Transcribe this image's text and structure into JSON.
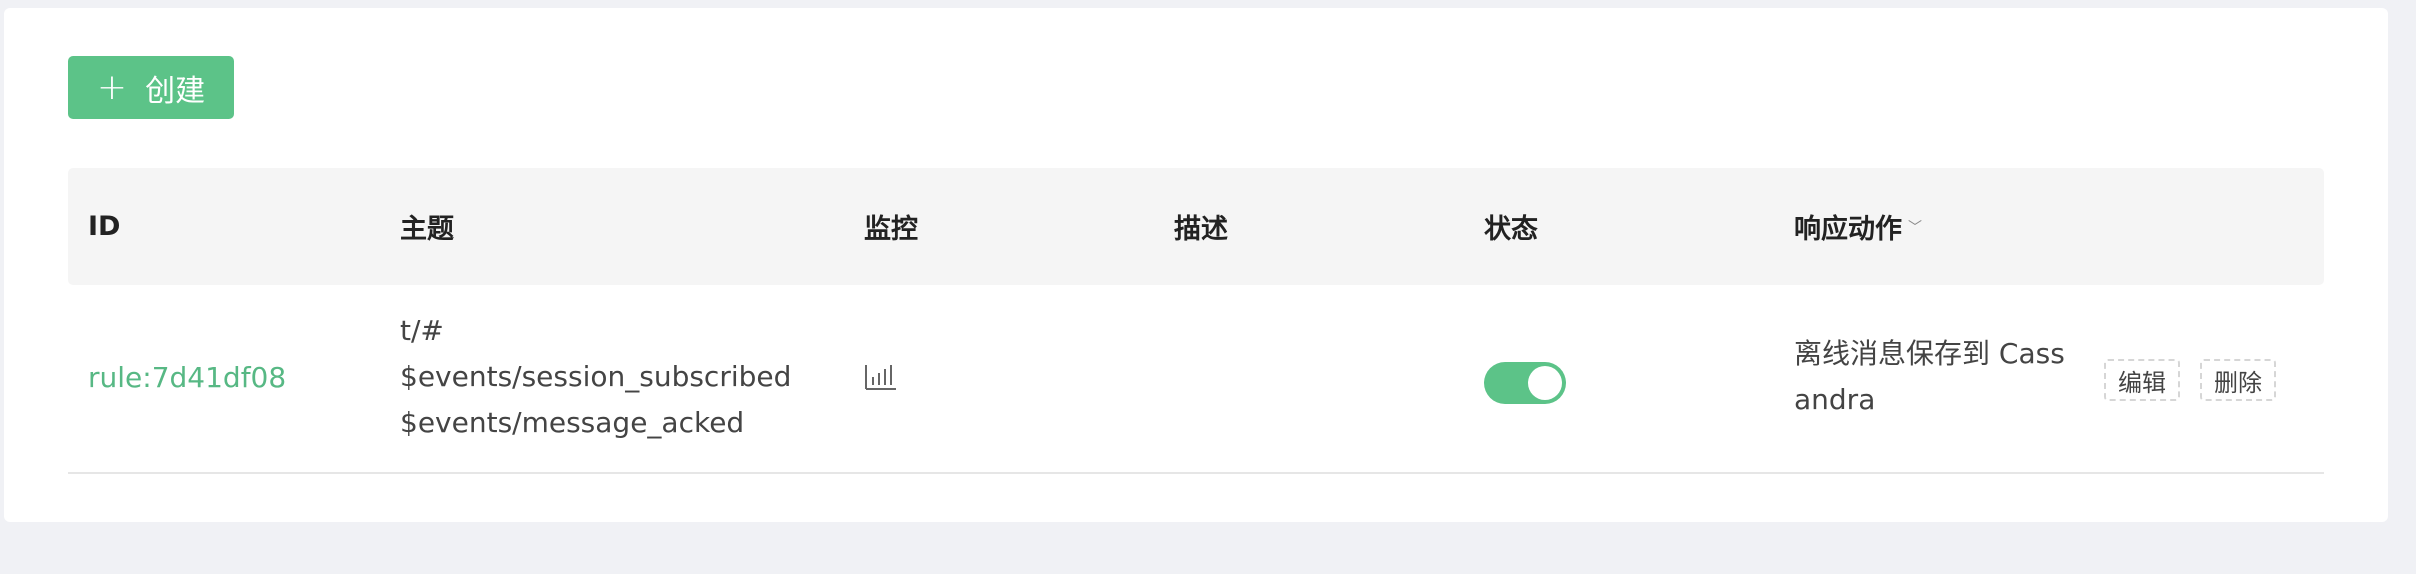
{
  "toolbar": {
    "create_icon": "+",
    "create_label": "创建"
  },
  "table": {
    "columns": {
      "id": "ID",
      "topic": "主题",
      "monitor": "监控",
      "description": "描述",
      "status": "状态",
      "actions": "响应动作"
    },
    "rows": [
      {
        "id": "rule:7d41df08",
        "topics": [
          "t/#",
          "$events/session_subscribed",
          "$events/message_acked"
        ],
        "monitor_icon": "bar-chart-icon",
        "description": "",
        "enabled": true,
        "action_lines": [
          "离线消息保存到 Cass",
          "andra"
        ],
        "edit_label": "编辑",
        "delete_label": "删除"
      }
    ]
  },
  "colors": {
    "accent": "#5cc388",
    "link": "#57b884",
    "header_bg": "#f5f5f5",
    "page_bg": "#f0f1f5"
  }
}
